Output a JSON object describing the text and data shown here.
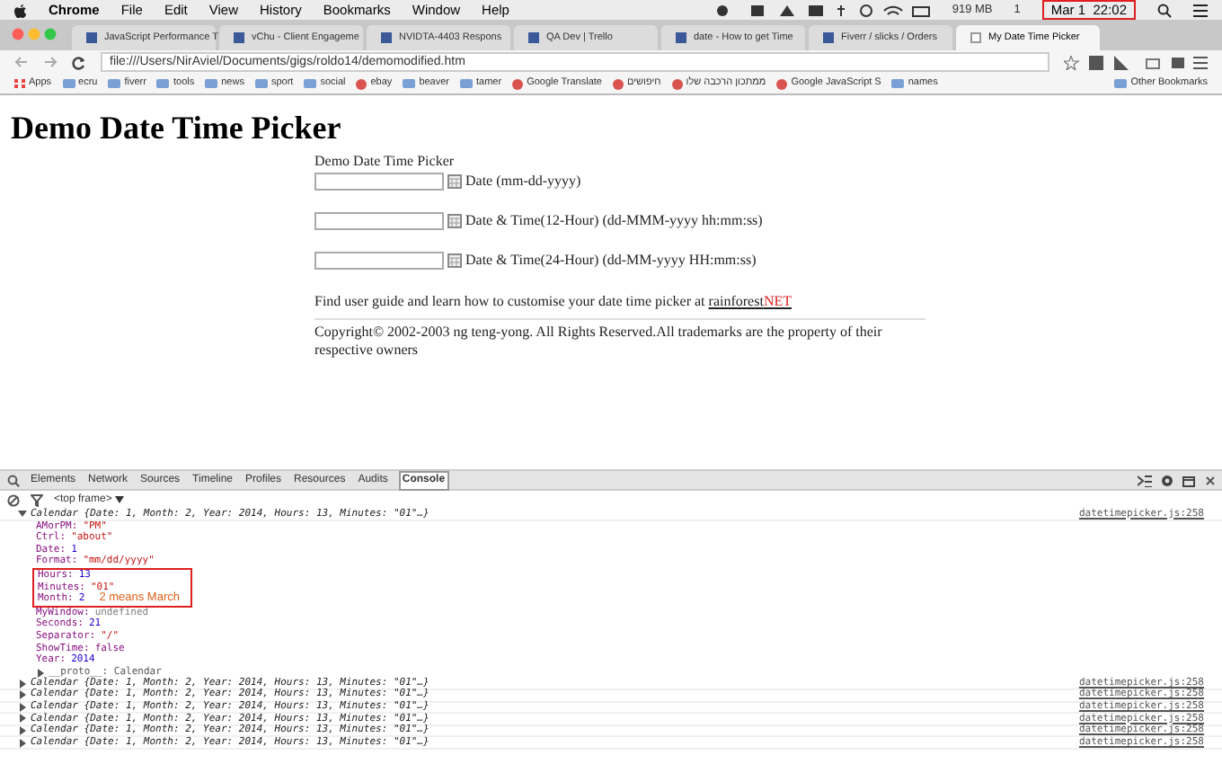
{
  "menu_bar": {
    "app": "Chrome",
    "items": [
      "File",
      "Edit",
      "View",
      "History",
      "Bookmarks",
      "Window",
      "Help"
    ],
    "memory": "919 MB",
    "badge": "1",
    "clock": "Mar 1  22:02"
  },
  "tabs": [
    {
      "label": "JavaScript Performance T",
      "selected": false
    },
    {
      "label": "vChu - Client Engageme",
      "selected": false
    },
    {
      "label": "NVIDTA-4403 Respons",
      "selected": false
    },
    {
      "label": "QA Dev | Trello",
      "selected": false
    },
    {
      "label": "date - How to get Time",
      "selected": false
    },
    {
      "label": "Fiverr / slicks / Orders",
      "selected": false
    },
    {
      "label": "My Date Time Picker",
      "selected": true
    }
  ],
  "address_bar": {
    "url": "file:///Users/NirAviel/Documents/gigs/roldo14/demomodified.htm"
  },
  "bookmarks": [
    {
      "label": "Apps",
      "kind": "apps"
    },
    {
      "label": "ecru",
      "kind": "folder"
    },
    {
      "label": "fiverr",
      "kind": "folder"
    },
    {
      "label": "tools",
      "kind": "folder"
    },
    {
      "label": "news",
      "kind": "folder"
    },
    {
      "label": "sport",
      "kind": "folder"
    },
    {
      "label": "social",
      "kind": "folder"
    },
    {
      "label": "ebay",
      "kind": "site"
    },
    {
      "label": "beaver",
      "kind": "folder"
    },
    {
      "label": "tamer",
      "kind": "folder"
    },
    {
      "label": "Google Translate",
      "kind": "site"
    },
    {
      "label": "חיפושים",
      "kind": "site"
    },
    {
      "label": "ממתכון הרכבה שלו",
      "kind": "site"
    },
    {
      "label": "Google JavaScript S",
      "kind": "site"
    },
    {
      "label": "names",
      "kind": "folder"
    },
    {
      "label": "Other Bookmarks",
      "kind": "folder"
    }
  ],
  "page": {
    "heading": "Demo Date Time Picker",
    "form_title": "Demo Date Time Picker",
    "fields": [
      {
        "label": "Date (mm-dd-yyyy)"
      },
      {
        "label": "Date & Time(12-Hour) (dd-MMM-yyyy hh:mm:ss)"
      },
      {
        "label": "Date & Time(24-Hour) (dd-MM-yyyy HH:mm:ss)"
      }
    ],
    "guide_text": "Find user guide and learn how to customise your date time picker at",
    "link_main": "rainforest",
    "link_suffix": "NET",
    "copyright": "Copyright© 2002-2003 ng teng-yong. All Rights Reserved.All trademarks are the property of their respective owners"
  },
  "devtools": {
    "tabs": [
      {
        "label": "Elements",
        "selected": false
      },
      {
        "label": "Network",
        "selected": false
      },
      {
        "label": "Sources",
        "selected": false
      },
      {
        "label": "Timeline",
        "selected": false
      },
      {
        "label": "Profiles",
        "selected": false
      },
      {
        "label": "Resources",
        "selected": false
      },
      {
        "label": "Audits",
        "selected": false
      },
      {
        "label": "Console",
        "selected": true
      }
    ],
    "frame": "<top frame>",
    "entries": [
      {
        "summary": "Calendar {Date: 1, Month: 2, Year: 2014, Hours: 13, Minutes: \"01\"…}",
        "expanded": true,
        "source": "datetimepicker.js:258",
        "properties": [
          {
            "key": "AMorPM:",
            "value": "\"PM\"",
            "kind": "string",
            "highlighted": false
          },
          {
            "key": "Ctrl:",
            "value": "\"about\"",
            "kind": "string",
            "highlighted": false
          },
          {
            "key": "Date:",
            "value": "1",
            "kind": "number",
            "highlighted": false
          },
          {
            "key": "Format:",
            "value": "\"mm/dd/yyyy\"",
            "kind": "string",
            "highlighted": false
          },
          {
            "key": "Hours:",
            "value": "13",
            "kind": "number",
            "highlighted": true
          },
          {
            "key": "Minutes:",
            "value": "\"01\"",
            "kind": "string",
            "highlighted": true
          },
          {
            "key": "Month:",
            "value": "2",
            "kind": "number",
            "highlighted": true,
            "note": "2 means March"
          },
          {
            "key": "MyWindow:",
            "value": "undefined",
            "kind": "undefined",
            "highlighted": false
          },
          {
            "key": "Seconds:",
            "value": "21",
            "kind": "number",
            "highlighted": false
          },
          {
            "key": "Separator:",
            "value": "\"/\"",
            "kind": "string",
            "highlighted": false
          },
          {
            "key": "ShowTime:",
            "value": "false",
            "kind": "boolean",
            "highlighted": false
          },
          {
            "key": "Year:",
            "value": "2014",
            "kind": "number",
            "highlighted": false
          }
        ],
        "proto": "__proto__: Calendar"
      },
      {
        "summary": "Calendar {Date: 1, Month: 2, Year: 2014, Hours: 13, Minutes: \"01\"…}",
        "expanded": false,
        "source": "datetimepicker.js:258"
      },
      {
        "summary": "Calendar {Date: 1, Month: 2, Year: 2014, Hours: 13, Minutes: \"01\"…}",
        "expanded": false,
        "source": "datetimepicker.js:258"
      },
      {
        "summary": "Calendar {Date: 1, Month: 2, Year: 2014, Hours: 13, Minutes: \"01\"…}",
        "expanded": false,
        "source": "datetimepicker.js:258"
      },
      {
        "summary": "Calendar {Date: 1, Month: 2, Year: 2014, Hours: 13, Minutes: \"01\"…}",
        "expanded": false,
        "source": "datetimepicker.js:258"
      },
      {
        "summary": "Calendar {Date: 1, Month: 2, Year: 2014, Hours: 13, Minutes: \"01\"…}",
        "expanded": false,
        "source": "datetimepicker.js:258"
      },
      {
        "summary": "Calendar {Date: 1, Month: 2, Year: 2014, Hours: 13, Minutes: \"01\"…}",
        "expanded": false,
        "source": "datetimepicker.js:258"
      }
    ]
  }
}
